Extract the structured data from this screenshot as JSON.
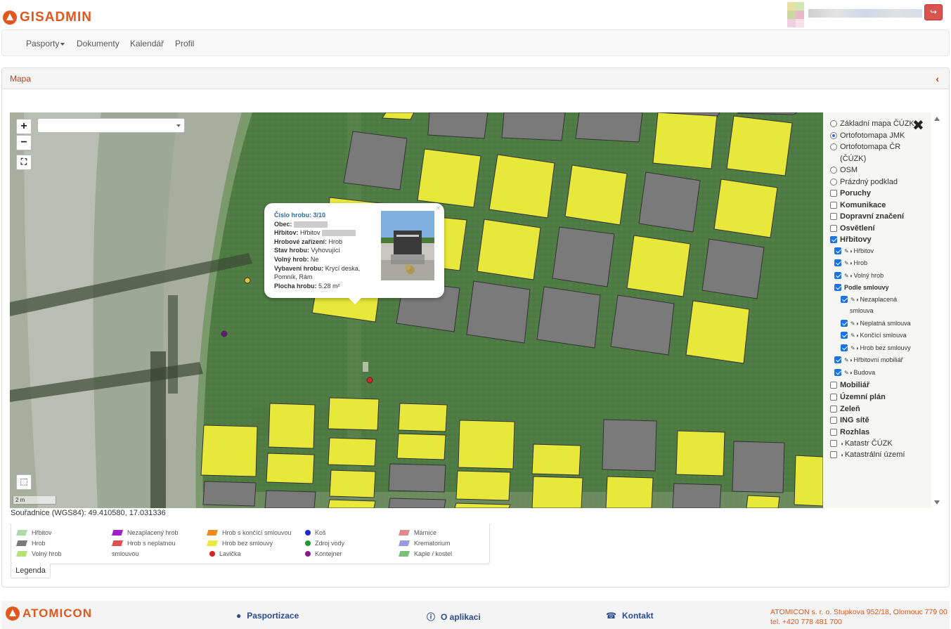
{
  "app": {
    "logo_text": "GISADMIN"
  },
  "nav": {
    "items": [
      "Pasporty",
      "Dokumenty",
      "Kalendář",
      "Profil"
    ]
  },
  "panel": {
    "title": "Mapa"
  },
  "map": {
    "scale_label": "2 m",
    "popup": {
      "title": "Číslo hrobu: 3/10",
      "obec_label": "Obec:",
      "hrbitov_label": "Hřbitov:",
      "hrbitov_value": "Hřbitov",
      "zarizeni_label": "Hrobové zařízení:",
      "zarizeni_value": "Hrob",
      "stav_label": "Stav hrobu:",
      "stav_value": "Vyhovující",
      "volny_label": "Volný hrob:",
      "volny_value": "Ne",
      "vybaveni_label": "Vybavení hrobu:",
      "vybaveni_value": "Krycí deska, Pomník, Rám",
      "plocha_label": "Plocha hrobu:",
      "plocha_value": "5.28 m²"
    }
  },
  "layers": [
    {
      "type": "radio",
      "label": "Základní mapa ČÚZK",
      "checked": false
    },
    {
      "type": "radio",
      "label": "Ortofotomapa JMK",
      "checked": true
    },
    {
      "type": "radio",
      "label": "Ortofotomapa ČR",
      "checked": false
    },
    {
      "type": "text",
      "label": "(ČÚZK)"
    },
    {
      "type": "radio",
      "label": "OSM",
      "checked": false
    },
    {
      "type": "radio",
      "label": "Prázdný podklad",
      "checked": false
    },
    {
      "type": "check",
      "label": "Poruchy",
      "checked": false
    },
    {
      "type": "check",
      "label": "Komunikace",
      "checked": false
    },
    {
      "type": "check",
      "label": "Dopravní značení",
      "checked": false
    },
    {
      "type": "check",
      "label": "Osvětlení",
      "checked": false
    },
    {
      "type": "check",
      "label": "Hřbitovy",
      "checked": true
    },
    {
      "type": "sub",
      "label": "Hřbitov",
      "checked": true
    },
    {
      "type": "sub",
      "label": "Hrob",
      "checked": true
    },
    {
      "type": "sub",
      "label": "Volný hrob",
      "checked": true
    },
    {
      "type": "subhead",
      "label": "Podle smlouvy",
      "checked": true
    },
    {
      "type": "sub2",
      "label": "Nezaplacená",
      "checked": true
    },
    {
      "type": "text2",
      "label": "smlouva"
    },
    {
      "type": "sub2",
      "label": "Neplatná smlouva",
      "checked": true
    },
    {
      "type": "sub2",
      "label": "Končící smlouva",
      "checked": true
    },
    {
      "type": "sub2",
      "label": "Hrob bez smlouvy",
      "checked": true
    },
    {
      "type": "sub",
      "label": "Hřbitovní mobiliář",
      "checked": true
    },
    {
      "type": "sub",
      "label": "Budova",
      "checked": true
    },
    {
      "type": "check",
      "label": "Mobiliář",
      "checked": false
    },
    {
      "type": "check",
      "label": "Územní plán",
      "checked": false
    },
    {
      "type": "check",
      "label": "Zeleň",
      "checked": false
    },
    {
      "type": "check",
      "label": "ING sítě",
      "checked": false
    },
    {
      "type": "check",
      "label": "Rozhlas",
      "checked": false
    },
    {
      "type": "checkico",
      "label": "Katastr ČÚZK",
      "checked": false
    },
    {
      "type": "checkico",
      "label": "Katastrální území",
      "checked": false
    }
  ],
  "coords": "Souřadnice (WGS84): 49.410580, 17.031336",
  "legend": {
    "tab_label": "Legenda",
    "items": [
      {
        "label": "Hřbitov",
        "kind": "poly",
        "color": "#a9dca9"
      },
      {
        "label": "Hrob",
        "kind": "poly",
        "color": "#7a7a7a"
      },
      {
        "label": "Volný hrob",
        "kind": "poly",
        "color": "#b6e07a"
      },
      {
        "label": "Nezaplacený hrob",
        "kind": "poly",
        "color": "#a020c8"
      },
      {
        "label": "Hrob s neplatnou",
        "kind": "poly",
        "color": "#e05050"
      },
      {
        "label": "smlouvou",
        "kind": "text"
      },
      {
        "label": "Hrob s končící smlouvou",
        "kind": "poly",
        "color": "#f08a20"
      },
      {
        "label": "Hrob bez smlouvy",
        "kind": "poly",
        "color": "#eaea40"
      },
      {
        "label": "Lavička",
        "kind": "dot",
        "color": "#e02020"
      },
      {
        "label": "Koš",
        "kind": "dot",
        "color": "#1a2ad0"
      },
      {
        "label": "Zdroj vody",
        "kind": "dot",
        "color": "#1a9a2a"
      },
      {
        "label": "Kontejner",
        "kind": "dot",
        "color": "#8a1a8a"
      },
      {
        "label": "Márnice",
        "kind": "poly",
        "color": "#e08a8a"
      },
      {
        "label": "Krematorium",
        "kind": "poly",
        "color": "#9a9ae0"
      },
      {
        "label": "Kaple / kostel",
        "kind": "poly",
        "color": "#7ac07a"
      }
    ]
  },
  "footer": {
    "logo_text": "ATOMICON",
    "links": [
      "Pasportizace",
      "O aplikaci",
      "Kontakt"
    ],
    "address_line1": "ATOMICON s. r. o. Stupkova 952/18, Olomouc 779 00",
    "address_line2": "tel. +420 778 481 700"
  },
  "colors": {
    "brand": "#e2571d",
    "grave_yellow": "#e8e83a",
    "grave_gray": "#7a7a7a"
  }
}
